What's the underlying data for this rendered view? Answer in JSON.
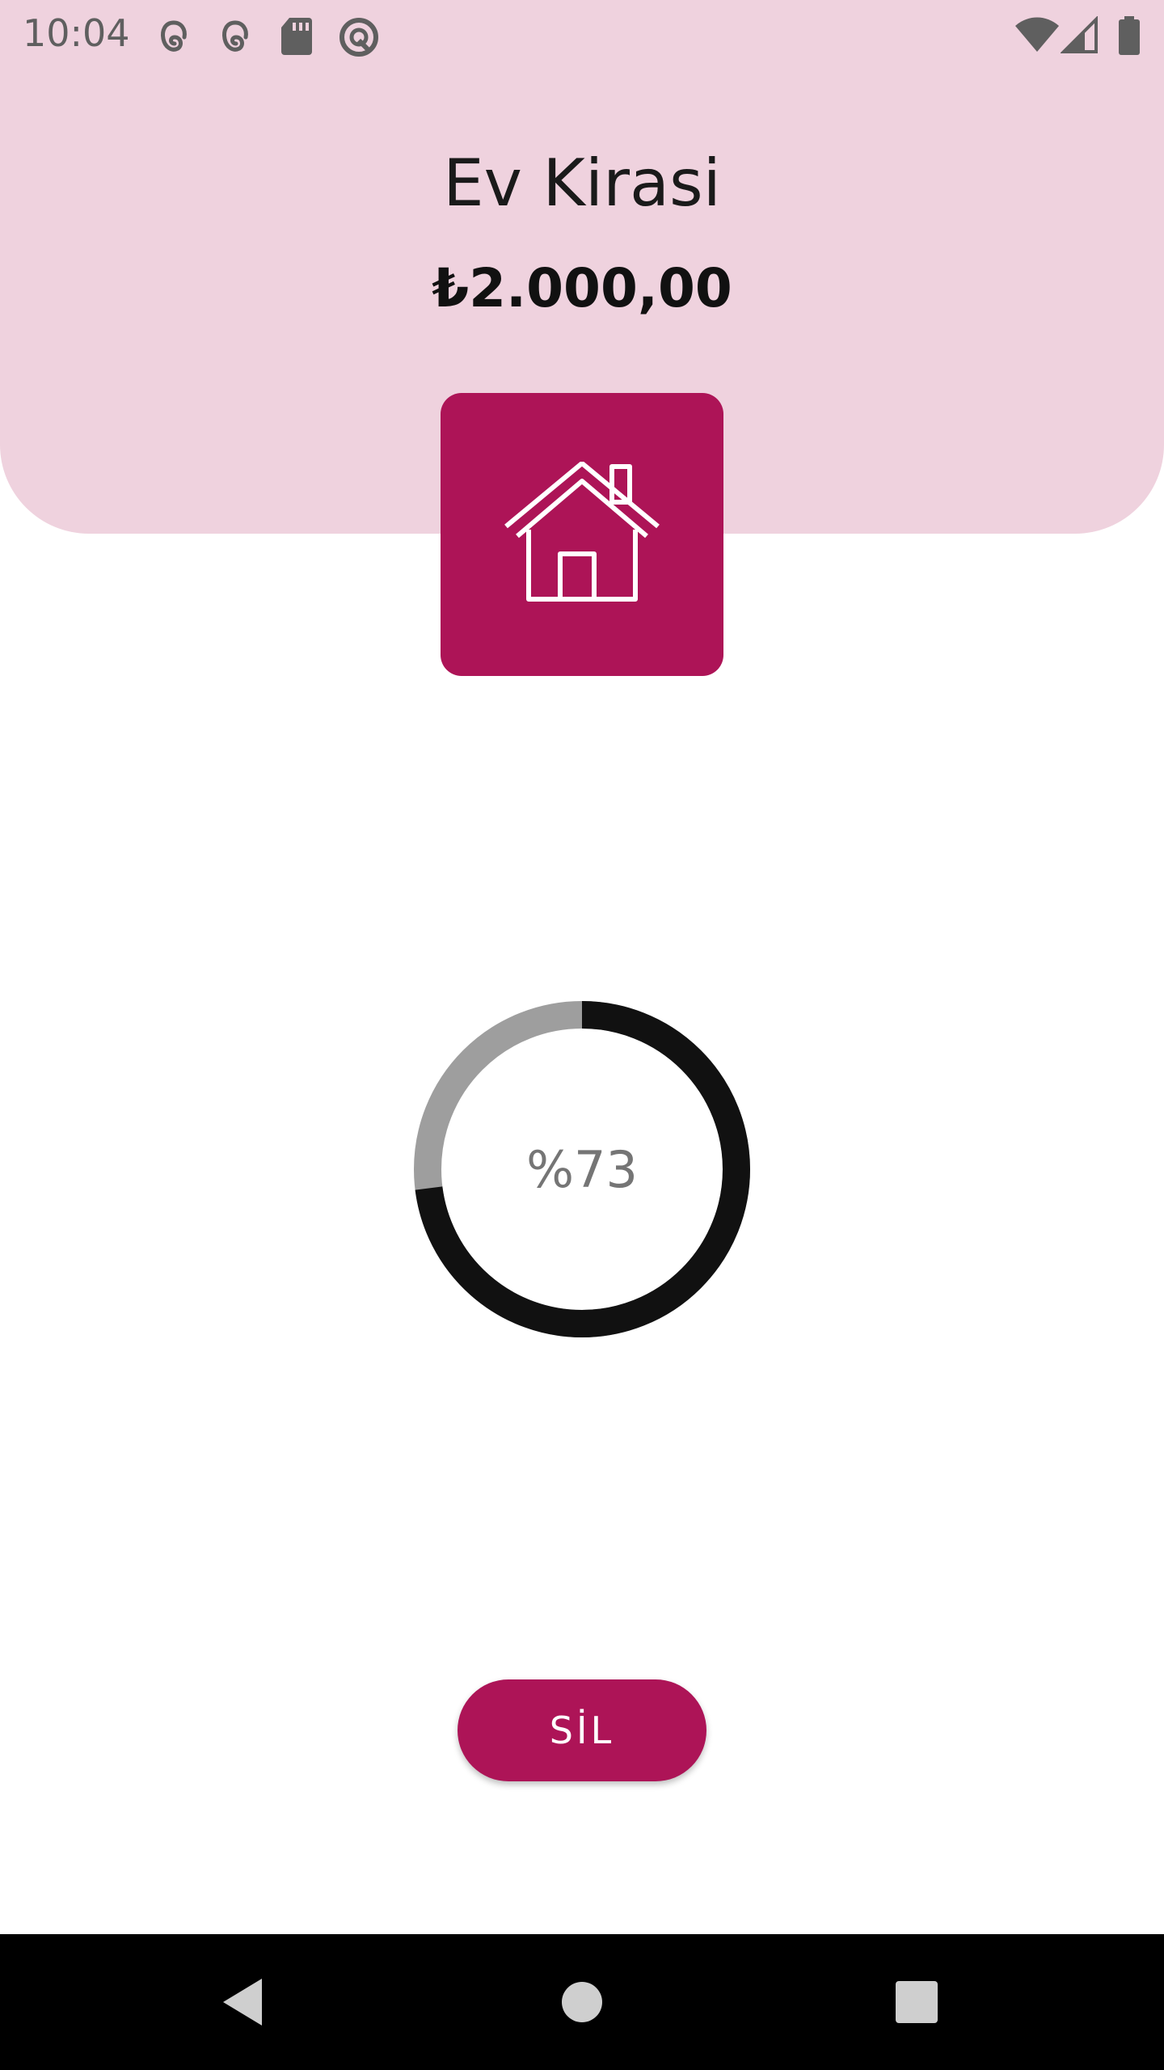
{
  "status_bar": {
    "time": "10:04",
    "left_icons": [
      "thread-icon",
      "thread-icon",
      "sd-card-icon",
      "no-sync-icon"
    ],
    "right_icons": [
      "wifi-icon",
      "signal-icon",
      "battery-icon"
    ]
  },
  "expense": {
    "title": "Ev Kirasi",
    "amount": "₺2.000,00",
    "category_icon": "house-icon",
    "accent_color": "#ad1457",
    "header_color": "#efd2de"
  },
  "progress": {
    "label": "%73",
    "value": 0.73
  },
  "actions": {
    "delete_label": "SİL"
  },
  "nav": {
    "buttons": [
      "back-icon",
      "home-icon",
      "recents-icon"
    ]
  }
}
